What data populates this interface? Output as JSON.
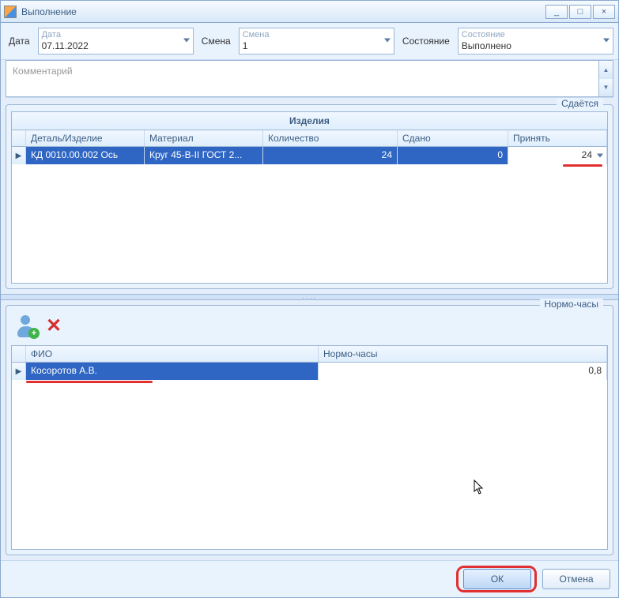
{
  "window": {
    "title": "Выполнение"
  },
  "filters": {
    "date": {
      "label": "Дата",
      "top": "Дата",
      "value": "07.11.2022"
    },
    "shift": {
      "label": "Смена",
      "top": "Смена",
      "value": "1"
    },
    "state": {
      "label": "Состояние",
      "top": "Состояние",
      "value": "Выполнено"
    }
  },
  "comment": {
    "placeholder": "Комментарий"
  },
  "products": {
    "legend": "Сдаётся",
    "title": "Изделия",
    "columns": [
      "Деталь/Изделие",
      "Материал",
      "Количество",
      "Сдано",
      "Принять"
    ],
    "rows": [
      {
        "part": "КД 0010.00.002 Ось",
        "mat": "Круг 45-В-II  ГОСТ 2...",
        "qty": "24",
        "done": "0",
        "accept": "24"
      }
    ]
  },
  "hours": {
    "legend": "Нормо-часы",
    "columns": [
      "ФИО",
      "Нормо-часы"
    ],
    "rows": [
      {
        "fio": "Косоротов А.В.",
        "h": "0,8"
      }
    ]
  },
  "footer": {
    "ok": "ОК",
    "cancel": "Отмена"
  }
}
